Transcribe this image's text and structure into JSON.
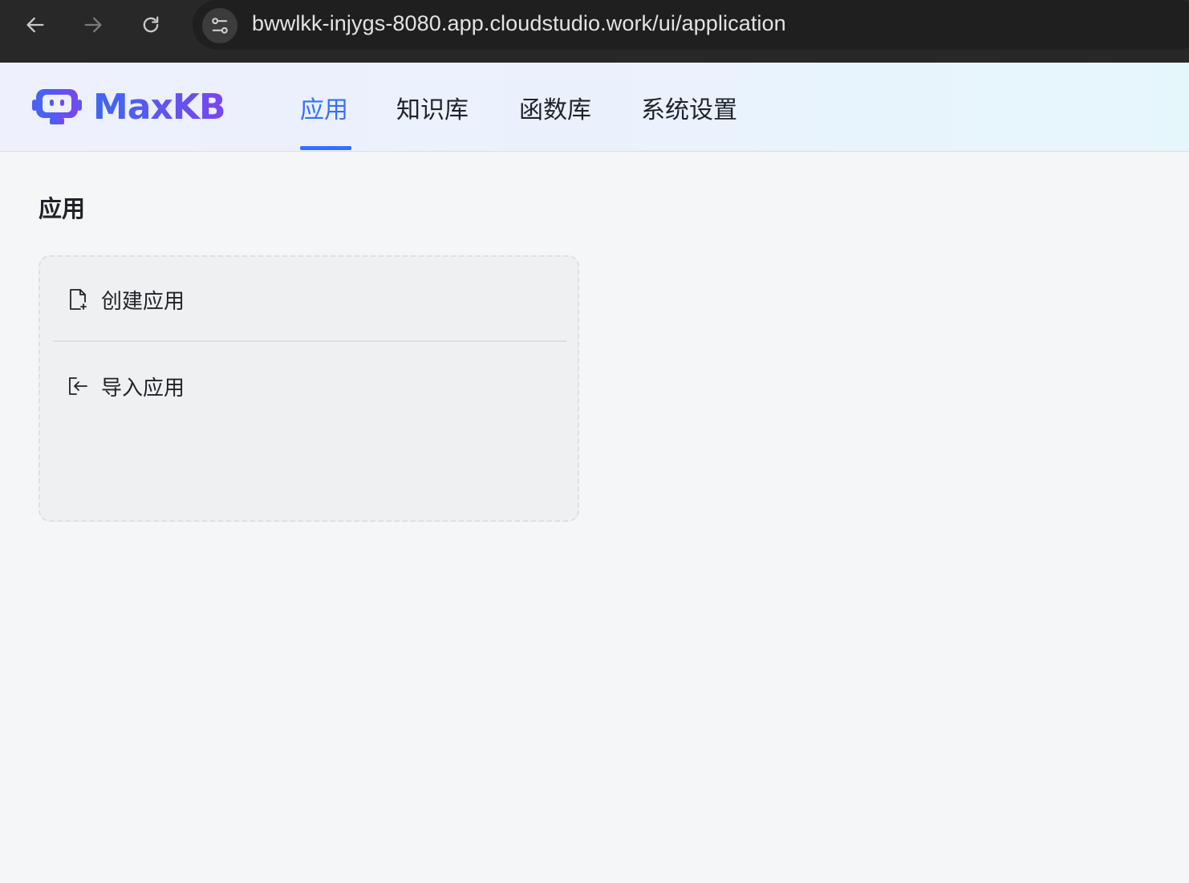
{
  "browser": {
    "url": "bwwlkk-injygs-8080.app.cloudstudio.work/ui/application",
    "back_icon": "arrow-left-icon",
    "forward_icon": "arrow-right-icon",
    "reload_icon": "reload-icon",
    "site_info_icon": "tune-icon"
  },
  "header": {
    "logo_text": "MaxKB",
    "logo_icon": "robot-icon",
    "tabs": [
      {
        "label": "应用",
        "active": true
      },
      {
        "label": "知识库",
        "active": false
      },
      {
        "label": "函数库",
        "active": false
      },
      {
        "label": "系统设置",
        "active": false
      }
    ]
  },
  "main": {
    "title": "应用",
    "create_card": {
      "items": [
        {
          "label": "创建应用",
          "icon": "file-add-icon"
        },
        {
          "label": "导入应用",
          "icon": "import-icon"
        }
      ]
    }
  },
  "colors": {
    "accent": "#3370ff",
    "logo_gradient_start": "#3f67f0",
    "logo_gradient_end": "#7a46f2",
    "text": "#1f2329"
  }
}
